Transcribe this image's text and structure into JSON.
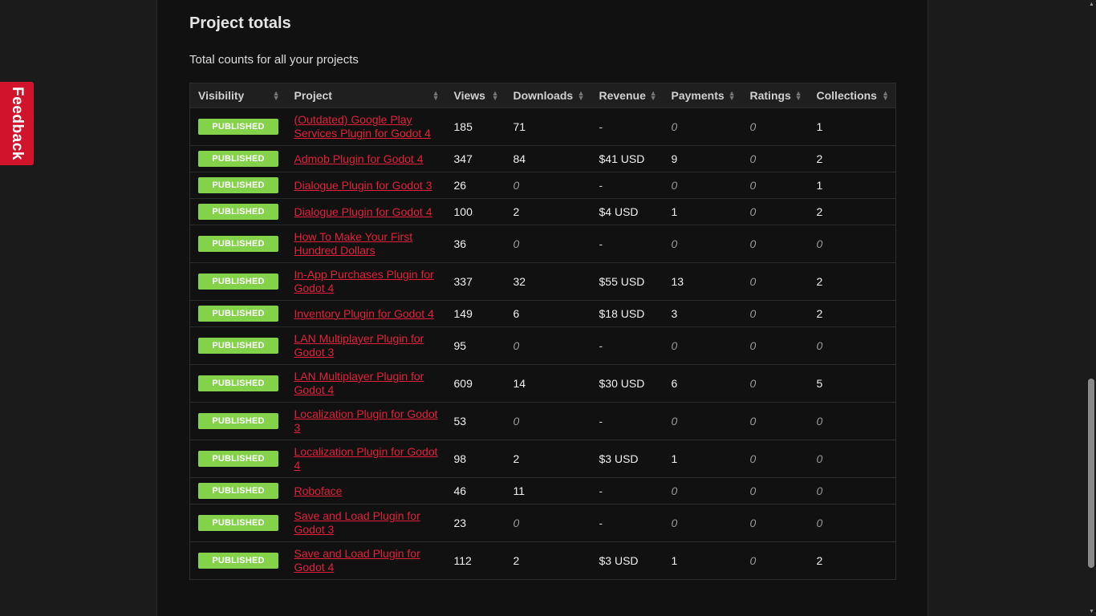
{
  "feedback": {
    "label": "Feedback"
  },
  "section": {
    "title": "Project totals",
    "description": "Total counts for all your projects"
  },
  "table": {
    "columns": [
      "Visibility",
      "Project",
      "Views",
      "Downloads",
      "Revenue",
      "Payments",
      "Ratings",
      "Collections"
    ],
    "rows": [
      {
        "visibility": "PUBLISHED",
        "project": "(Outdated) Google Play Services Plugin for Godot 4",
        "views": "185",
        "downloads": "71",
        "revenue": "-",
        "payments": "0",
        "ratings": "0",
        "collections": "1"
      },
      {
        "visibility": "PUBLISHED",
        "project": "Admob Plugin for Godot 4",
        "views": "347",
        "downloads": "84",
        "revenue": "$41 USD",
        "payments": "9",
        "ratings": "0",
        "collections": "2"
      },
      {
        "visibility": "PUBLISHED",
        "project": "Dialogue Plugin for Godot 3",
        "views": "26",
        "downloads": "0",
        "revenue": "-",
        "payments": "0",
        "ratings": "0",
        "collections": "1"
      },
      {
        "visibility": "PUBLISHED",
        "project": "Dialogue Plugin for Godot 4",
        "views": "100",
        "downloads": "2",
        "revenue": "$4 USD",
        "payments": "1",
        "ratings": "0",
        "collections": "2"
      },
      {
        "visibility": "PUBLISHED",
        "project": "How To Make Your First Hundred Dollars",
        "views": "36",
        "downloads": "0",
        "revenue": "-",
        "payments": "0",
        "ratings": "0",
        "collections": "0"
      },
      {
        "visibility": "PUBLISHED",
        "project": "In-App Purchases Plugin for Godot 4",
        "views": "337",
        "downloads": "32",
        "revenue": "$55 USD",
        "payments": "13",
        "ratings": "0",
        "collections": "2"
      },
      {
        "visibility": "PUBLISHED",
        "project": "Inventory Plugin for Godot 4",
        "views": "149",
        "downloads": "6",
        "revenue": "$18 USD",
        "payments": "3",
        "ratings": "0",
        "collections": "2"
      },
      {
        "visibility": "PUBLISHED",
        "project": "LAN Multiplayer Plugin for Godot 3",
        "views": "95",
        "downloads": "0",
        "revenue": "-",
        "payments": "0",
        "ratings": "0",
        "collections": "0"
      },
      {
        "visibility": "PUBLISHED",
        "project": "LAN Multiplayer Plugin for Godot 4",
        "views": "609",
        "downloads": "14",
        "revenue": "$30 USD",
        "payments": "6",
        "ratings": "0",
        "collections": "5"
      },
      {
        "visibility": "PUBLISHED",
        "project": "Localization Plugin for Godot 3",
        "views": "53",
        "downloads": "0",
        "revenue": "-",
        "payments": "0",
        "ratings": "0",
        "collections": "0"
      },
      {
        "visibility": "PUBLISHED",
        "project": "Localization Plugin for Godot 4",
        "views": "98",
        "downloads": "2",
        "revenue": "$3 USD",
        "payments": "1",
        "ratings": "0",
        "collections": "0"
      },
      {
        "visibility": "PUBLISHED",
        "project": "Roboface",
        "views": "46",
        "downloads": "11",
        "revenue": "-",
        "payments": "0",
        "ratings": "0",
        "collections": "0"
      },
      {
        "visibility": "PUBLISHED",
        "project": "Save and Load Plugin for Godot 3",
        "views": "23",
        "downloads": "0",
        "revenue": "-",
        "payments": "0",
        "ratings": "0",
        "collections": "0"
      },
      {
        "visibility": "PUBLISHED",
        "project": "Save and Load Plugin for Godot 4",
        "views": "112",
        "downloads": "2",
        "revenue": "$3 USD",
        "payments": "1",
        "ratings": "0",
        "collections": "2"
      }
    ]
  },
  "colors": {
    "accent": "#e0213c",
    "published_badge": "#84d24a",
    "feedback_tab": "#d0142c"
  }
}
